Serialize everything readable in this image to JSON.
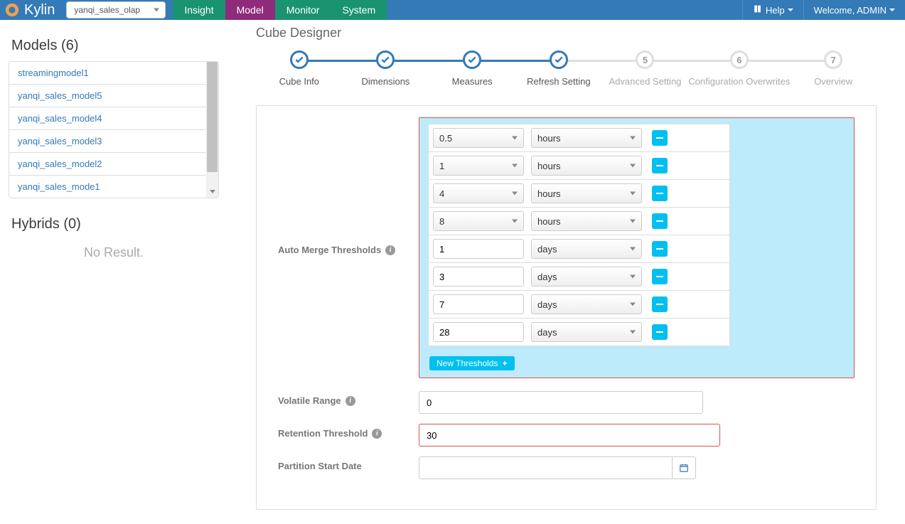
{
  "brand": "Kylin",
  "project_selector": {
    "value": "yanqi_sales_olap"
  },
  "nav": {
    "insight": "Insight",
    "model": "Model",
    "monitor": "Monitor",
    "system": "System",
    "help": "Help",
    "welcome": "Welcome, ADMIN"
  },
  "sidebar": {
    "models_title": "Models (6)",
    "models": [
      "streamingmodel1",
      "yanqi_sales_model5",
      "yanqi_sales_model4",
      "yanqi_sales_model3",
      "yanqi_sales_model2",
      "yanqi_sales_mode1"
    ],
    "hybrids_title": "Hybrids (0)",
    "no_result": "No Result."
  },
  "designer": {
    "title": "Cube Designer",
    "steps": [
      {
        "label": "Cube Info",
        "state": "done"
      },
      {
        "label": "Dimensions",
        "state": "done"
      },
      {
        "label": "Measures",
        "state": "done"
      },
      {
        "label": "Refresh Setting",
        "state": "done"
      },
      {
        "label": "Advanced Setting",
        "state": "pending",
        "num": "5"
      },
      {
        "label": "Configuration Overwrites",
        "state": "pending",
        "num": "6"
      },
      {
        "label": "Overview",
        "state": "pending",
        "num": "7"
      }
    ],
    "auto_merge_label": "Auto Merge Thresholds",
    "thresholds": [
      {
        "value": "0.5",
        "unit": "hours",
        "value_as_select": true
      },
      {
        "value": "1",
        "unit": "hours",
        "value_as_select": true
      },
      {
        "value": "4",
        "unit": "hours",
        "value_as_select": true
      },
      {
        "value": "8",
        "unit": "hours",
        "value_as_select": true
      },
      {
        "value": "1",
        "unit": "days",
        "value_as_select": false
      },
      {
        "value": "3",
        "unit": "days",
        "value_as_select": false
      },
      {
        "value": "7",
        "unit": "days",
        "value_as_select": false
      },
      {
        "value": "28",
        "unit": "days",
        "value_as_select": false
      }
    ],
    "new_thresholds_label": "New Thresholds",
    "volatile_label": "Volatile Range",
    "volatile_value": "0",
    "retention_label": "Retention Threshold",
    "retention_value": "30",
    "partition_label": "Partition Start Date",
    "partition_value": ""
  }
}
